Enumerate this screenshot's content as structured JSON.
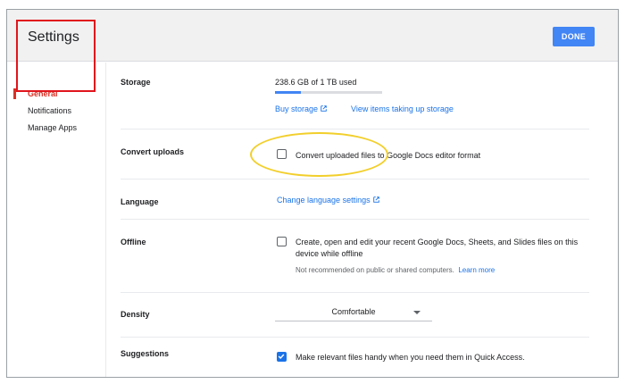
{
  "header": {
    "title": "Settings",
    "done_label": "DONE"
  },
  "sidebar": {
    "items": [
      {
        "label": "General",
        "active": true
      },
      {
        "label": "Notifications",
        "active": false
      },
      {
        "label": "Manage Apps",
        "active": false
      }
    ]
  },
  "storage": {
    "label": "Storage",
    "usage_text": "238.6 GB of 1 TB used",
    "usage_fraction": 0.2386,
    "buy_link": "Buy storage",
    "view_link": "View items taking up storage"
  },
  "convert": {
    "label": "Convert uploads",
    "checkbox_label": "Convert uploaded files to Google Docs editor format",
    "checked": false
  },
  "language": {
    "label": "Language",
    "link": "Change language settings"
  },
  "offline": {
    "label": "Offline",
    "checkbox_label_line1": "Create, open and edit your recent Google Docs, Sheets, and Slides files on this",
    "checkbox_label_line2": "device while offline",
    "note": "Not recommended on public or shared computers.",
    "learn_more": "Learn more",
    "checked": false
  },
  "density": {
    "label": "Density",
    "selected": "Comfortable"
  },
  "suggestions": {
    "label": "Suggestions",
    "checkbox_label": "Make relevant files handy when you need them in Quick Access.",
    "checked": true
  },
  "colors": {
    "accent_blue": "#4285f4",
    "link_blue": "#1a73e8",
    "active_red": "#d93025",
    "annotation_red": "#e0151c",
    "annotation_yellow": "#f2cf2c"
  }
}
